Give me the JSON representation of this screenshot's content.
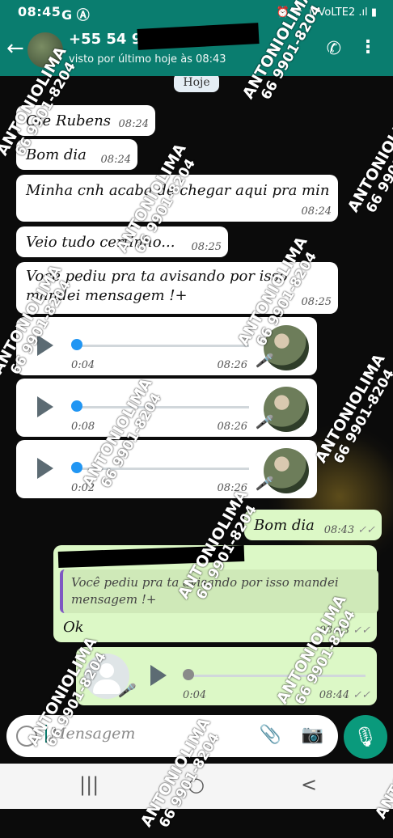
{
  "status_bar": {
    "time": "08:45",
    "indicators": "G Ⓐ",
    "right": "⏰ ᯤ .ıl VoLTE2 .ıl ▮"
  },
  "header": {
    "back_icon": "arrow-left-icon",
    "contact_name": "+55 54 9",
    "last_seen": "visto por último hoje às 08:43"
  },
  "chat": {
    "date_chip": "Hoje",
    "messages": [
      {
        "text": "Oie Rubens",
        "time": "08:24"
      },
      {
        "text": "Bom dia",
        "time": "08:24"
      },
      {
        "text": "Minha cnh acaba de chegar aqui pra min",
        "time": "08:24"
      },
      {
        "text": "Veio tudo certinho...",
        "time": "08:25"
      },
      {
        "text_line1": "Você pediu pra ta avisando por isso",
        "text_line2": "mandei mensagem !+",
        "time": "08:25"
      }
    ],
    "voice_messages": [
      {
        "duration": "0:04",
        "time": "08:26",
        "progress": 0
      },
      {
        "duration": "0:08",
        "time": "08:26",
        "progress": 0
      },
      {
        "duration": "0:02",
        "time": "08:26",
        "progress": 0
      }
    ],
    "outgoing": [
      {
        "text": "Bom dia",
        "time": "08:43",
        "ticks": "✓✓"
      },
      {
        "quote_line1": "Você pediu pra ta avisando por isso mandei",
        "quote_line2": "mensagem !+",
        "text": "Ok",
        "time": "08:43",
        "ticks": "✓✓"
      },
      {
        "duration": "0:04",
        "time": "08:44",
        "ticks": "✓✓",
        "progress": 0
      }
    ]
  },
  "input": {
    "placeholder": "Mensagem"
  },
  "nav": {
    "recents": "|||",
    "home": "○",
    "back": "<"
  },
  "watermark": {
    "line1": "ANTONIOLIMA",
    "line2": "66 9901-8204"
  },
  "colors": {
    "header": "#0a7d6f",
    "incoming": "#ffffff",
    "outgoing": "#dcf8c6",
    "accent": "#2196f3"
  }
}
